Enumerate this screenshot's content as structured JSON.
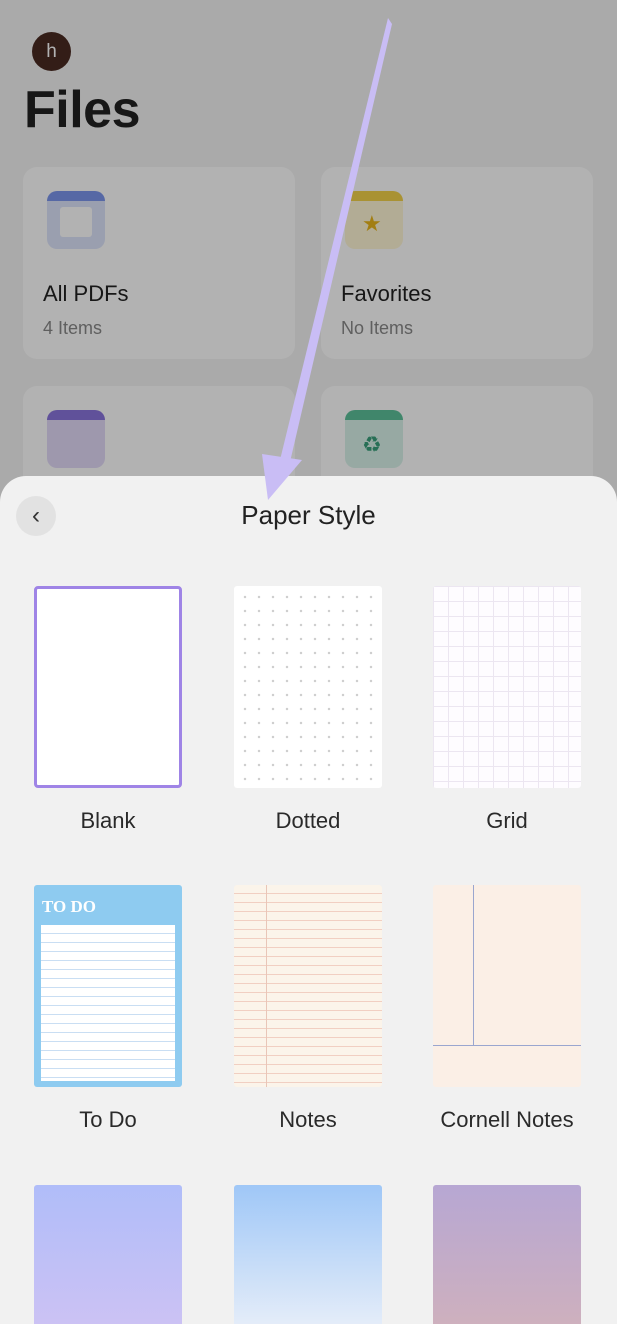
{
  "background": {
    "avatar_initial": "h",
    "title": "Files",
    "cards": [
      {
        "name": "All PDFs",
        "count": "4 Items",
        "icon": "pdf-folder-icon"
      },
      {
        "name": "Favorites",
        "count": "No Items",
        "icon": "star-folder-icon"
      },
      {
        "name": "",
        "count": "",
        "icon": "box-folder-icon"
      },
      {
        "name": "",
        "count": "",
        "icon": "recycle-bin-icon"
      }
    ]
  },
  "sheet": {
    "title": "Paper Style",
    "back_icon": "chevron-left-icon",
    "styles": [
      {
        "label": "Blank",
        "selected": true
      },
      {
        "label": "Dotted"
      },
      {
        "label": "Grid"
      },
      {
        "label": "To Do",
        "header_text": "TO DO"
      },
      {
        "label": "Notes"
      },
      {
        "label": "Cornell Notes"
      },
      {
        "label": ""
      },
      {
        "label": ""
      },
      {
        "label": ""
      }
    ]
  },
  "colors": {
    "accent": "#9f84e6",
    "arrow": "#c9bdf5"
  }
}
